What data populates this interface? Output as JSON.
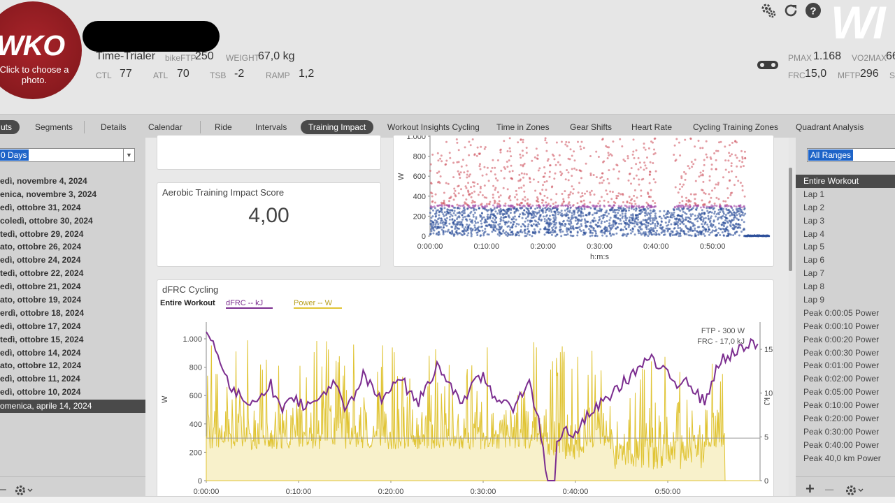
{
  "header": {
    "logo_text": "WKO",
    "logo_hint": "Click to choose a photo.",
    "athlete_type": "Time-Trialer",
    "bike_ftp_label": "bikeFTP",
    "bike_ftp_value": "250",
    "weight_label": "WEIGHT",
    "weight_value": "67,0 kg",
    "ctl_label": "CTL",
    "ctl_value": "77",
    "atl_label": "ATL",
    "atl_value": "70",
    "tsb_label": "TSB",
    "tsb_value": "-2",
    "ramp_label": "RAMP",
    "ramp_value": "1,2",
    "pmax_label": "PMAX",
    "pmax_value": "1.168",
    "vo2max_label": "VO2MAX",
    "vo2max_value": "66",
    "frc_label": "FRC",
    "frc_value": "15,0",
    "mftp_label": "MFTP",
    "mftp_value": "296",
    "stp_label": "S",
    "corner_logo": "WI"
  },
  "tabs": [
    {
      "label": "uts"
    },
    {
      "label": "Segments"
    },
    {
      "label": "Details"
    },
    {
      "label": "Calendar"
    },
    {
      "label": "Ride"
    },
    {
      "label": "Intervals"
    },
    {
      "label": "Training Impact"
    },
    {
      "label": "Workout Insights Cycling"
    },
    {
      "label": "Time in Zones"
    },
    {
      "label": "Gear Shifts"
    },
    {
      "label": "Heart Rate"
    },
    {
      "label": "Cycling Training Zones"
    },
    {
      "label": "Quadrant Analysis"
    }
  ],
  "left": {
    "range_value": "0 Days",
    "workouts": [
      "edì, novembre 4, 2024",
      "enica, novembre 3, 2024",
      "edì, ottobre 31, 2024",
      "coledì, ottobre 30, 2024",
      "tedì, ottobre 29, 2024",
      "ato, ottobre 26, 2024",
      "edì, ottobre 24, 2024",
      "tedì, ottobre 22, 2024",
      "edì, ottobre 21, 2024",
      "ato, ottobre 19, 2024",
      "erdì, ottobre 18, 2024",
      "edì, ottobre 17, 2024",
      "tedì, ottobre 15, 2024",
      "edì, ottobre 14, 2024",
      "ato, ottobre 12, 2024",
      "edì, ottobre 11, 2024",
      "edì, ottobre 10, 2024"
    ],
    "selected_workout": "omenica, aprile 14, 2024"
  },
  "right": {
    "range_filter": "All Ranges",
    "items": [
      "Entire Workout",
      "Lap 1",
      "Lap 2",
      "Lap 3",
      "Lap 4",
      "Lap 5",
      "Lap 6",
      "Lap 7",
      "Lap 8",
      "Lap 9",
      "Peak 0:00:05 Power",
      "Peak 0:00:10 Power",
      "Peak 0:00:20 Power",
      "Peak 0:00:30 Power",
      "Peak 0:01:00 Power",
      "Peak 0:02:00 Power",
      "Peak 0:05:00 Power",
      "Peak 0:10:00 Power",
      "Peak 0:20:00 Power",
      "Peak 0:30:00 Power",
      "Peak 0:40:00 Power",
      "Peak 40,0 km Power"
    ]
  },
  "cards": {
    "aerobic_title": "Aerobic Training Impact Score",
    "aerobic_value": "4,00",
    "dfrc_title": "dFRC Cycling",
    "dfrc_range": "Entire Workout",
    "legend_dfrc": "dFRC  -- kJ",
    "legend_power": "Power  -- W",
    "ftp_note": "FTP - 300 W",
    "frc_note": "FRC - 17,0 kJ"
  },
  "colors": {
    "dfrc_line": "#7b2d8f",
    "power_fill": "#e0c434",
    "scatter_high": "#d05a66",
    "scatter_mid": "#a04aa8",
    "scatter_low": "#2c4f9a",
    "accent_select": "#1e64c8"
  },
  "chart_data": [
    {
      "type": "scatter",
      "title": "",
      "xlabel": "h:m:s",
      "ylabel": "W",
      "x_ticks": [
        "0:00:00",
        "0:10:00",
        "0:20:00",
        "0:30:00",
        "0:40:00",
        "0:50:00"
      ],
      "y_ticks": [
        "0",
        "200",
        "400",
        "600",
        "800",
        "1.000"
      ],
      "ylim": [
        0,
        1000
      ],
      "xlim_minutes": [
        0,
        60
      ],
      "series": [
        {
          "points_description": "dense power samples 0–300 W (blue), sparse 300–1000 W (red), ending ~56 min"
        }
      ]
    },
    {
      "type": "line",
      "title": "dFRC Cycling",
      "x_ticks": [
        "0:00:00",
        "0:10:00",
        "0:20:00",
        "0:30:00",
        "0:40:00",
        "0:50:00"
      ],
      "y_left_ticks": [
        "0",
        "200",
        "400",
        "600",
        "800",
        "1.000"
      ],
      "y_right_ticks": [
        "0",
        "5",
        "10",
        "15"
      ],
      "ylabel": "W",
      "ylabel_right": "kJ",
      "ylim": [
        0,
        1000
      ],
      "ylim_right": [
        0,
        17
      ],
      "ftp_line_w": 300,
      "series": [
        {
          "name": "dFRC",
          "unit": "kJ",
          "x_min": [
            0,
            1,
            2,
            3,
            4,
            5,
            6,
            7,
            8,
            9,
            10,
            11,
            12,
            13,
            14,
            15,
            16,
            17,
            18,
            19,
            20,
            21,
            22,
            23,
            24,
            25,
            26,
            27,
            28,
            29,
            30,
            31,
            32,
            33,
            34,
            35,
            36,
            37,
            38,
            39,
            40,
            41,
            42,
            43,
            44,
            45,
            46,
            47,
            48,
            49,
            50,
            51,
            52,
            53,
            54,
            55,
            56,
            57,
            58,
            59
          ],
          "values": [
            17,
            15.5,
            12,
            10,
            9.5,
            9,
            10,
            11,
            8,
            10,
            9,
            8.5,
            9,
            10.5,
            11,
            8,
            9.5,
            12,
            10.5,
            9,
            11,
            12,
            10,
            9,
            11,
            13,
            12,
            10,
            9,
            11,
            12,
            10,
            9,
            8,
            10,
            11,
            7,
            0,
            4,
            6,
            5,
            7,
            8,
            9,
            10,
            11,
            12,
            13,
            14,
            13,
            12,
            11,
            12,
            10,
            9,
            12,
            14,
            14.5,
            15,
            15.5
          ]
        },
        {
          "name": "Power",
          "unit": "W",
          "values_description": "high-frequency power trace 0–1000 W, drop to ~0 after 56 min"
        }
      ]
    }
  ]
}
